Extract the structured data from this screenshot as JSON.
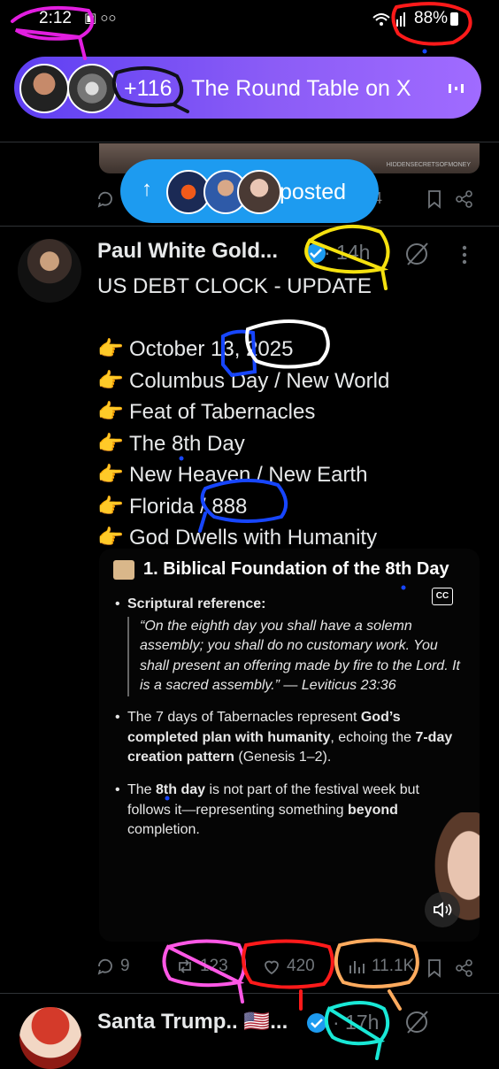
{
  "status_bar": {
    "time": "2:12",
    "icons_text": "▣ ○○",
    "battery": "88%"
  },
  "spaces": {
    "listeners": "+116",
    "separator": " · ",
    "title": "The Round Table on X"
  },
  "posted_pill": {
    "arrow": "↑",
    "label": "posted"
  },
  "prev_tweet": {
    "image_caption": "HIDDENSECRETSOFMONEY",
    "partial_count": "4"
  },
  "tweet": {
    "author": "Paul White Gold...",
    "time": "· 14h",
    "headline": "US DEBT CLOCK - UPDATE",
    "lines": [
      "October 13, 2025",
      "Columbus Day / New World",
      "Feat of Tabernacles",
      "The 8th Day",
      "New Heaven / New Earth",
      "Florida / 888",
      "God Dwells with Humanity"
    ],
    "media": {
      "heading": "1. Biblical Foundation of the 8th Day",
      "cc": "CC",
      "bullet1_label": "Scriptural reference:",
      "bullet1_quote": "“On the eighth day you shall have a solemn assembly; you shall do no customary work. You shall present an offering made by fire to the Lord. It is a sacred assembly.” — Leviticus 23:36",
      "bullet2_a": "The 7 days of Tabernacles represent ",
      "bullet2_b": "God’s completed plan with humanity",
      "bullet2_c": ", echoing the ",
      "bullet2_d": "7-day creation pattern",
      "bullet2_e": " (Genesis 1–2).",
      "bullet3_a": "The ",
      "bullet3_b": "8th day",
      "bullet3_c": " is not part of the festival week but follows it—representing something ",
      "bullet3_d": "beyond",
      "bullet3_e": " completion."
    },
    "actions": {
      "replies": "9",
      "reposts": "123",
      "likes": "420",
      "views": "11.1K"
    }
  },
  "next_tweet": {
    "author": "Santa Trump.. 🇺🇸...",
    "time": "· 17h"
  },
  "colors": {
    "accent_blue": "#1d9bf0",
    "spaces_purple": "#7c4dff",
    "muted_gray": "#71767b",
    "annotation_magenta": "#e21ee0",
    "annotation_red": "#ff1a1a",
    "annotation_yellow": "#f5e10f",
    "annotation_blue": "#1746ff",
    "annotation_orange": "#ffab5e",
    "annotation_cyan": "#19e8d6",
    "annotation_pink": "#ff58e6"
  }
}
